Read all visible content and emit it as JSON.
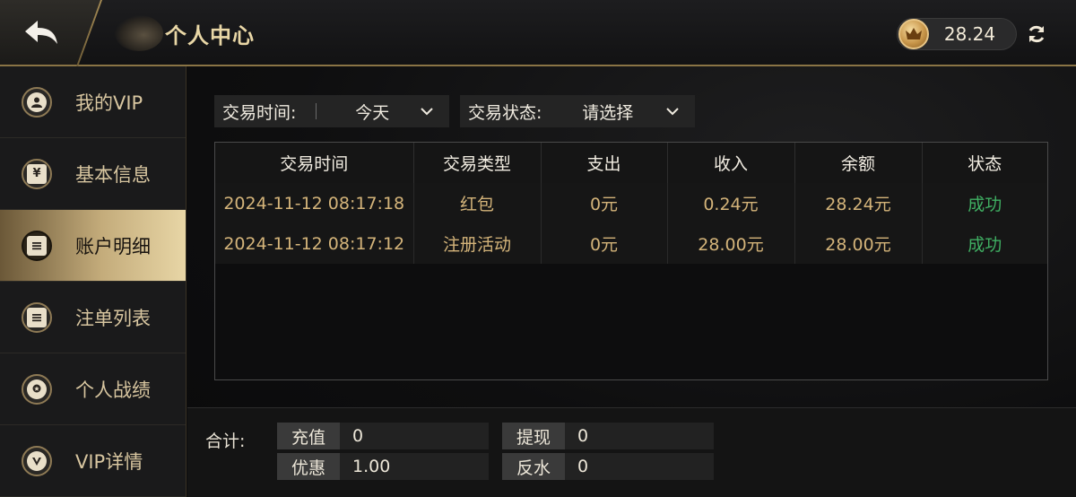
{
  "header": {
    "title": "个人中心",
    "balance": "28.24"
  },
  "sidebar": {
    "items": [
      {
        "label": "我的VIP",
        "icon": "user-icon",
        "active": false
      },
      {
        "label": "基本信息",
        "icon": "yen-icon",
        "active": false
      },
      {
        "label": "账户明细",
        "icon": "list-icon",
        "active": true
      },
      {
        "label": "注单列表",
        "icon": "list-icon",
        "active": false
      },
      {
        "label": "个人战绩",
        "icon": "medal-icon",
        "active": false
      },
      {
        "label": "VIP详情",
        "icon": "vip-icon",
        "active": false
      }
    ]
  },
  "filters": {
    "time_label": "交易时间:",
    "time_value": "今天",
    "status_label": "交易状态:",
    "status_value": "请选择"
  },
  "table": {
    "headers": [
      "交易时间",
      "交易类型",
      "支出",
      "收入",
      "余额",
      "状态"
    ],
    "rows": [
      [
        "2024-11-12 08:17:18",
        "红包",
        "0元",
        "0.24元",
        "28.24元",
        "成功"
      ],
      [
        "2024-11-12 08:17:12",
        "注册活动",
        "0元",
        "28.00元",
        "28.00元",
        "成功"
      ]
    ]
  },
  "summary": {
    "label": "合计:",
    "recharge_label": "充值",
    "recharge_value": "0",
    "withdraw_label": "提现",
    "withdraw_value": "0",
    "discount_label": "优惠",
    "discount_value": "1.00",
    "rebate_label": "反水",
    "rebate_value": "0"
  },
  "colors": {
    "accent_gold": "#d4b47a",
    "success": "#3fae62"
  }
}
